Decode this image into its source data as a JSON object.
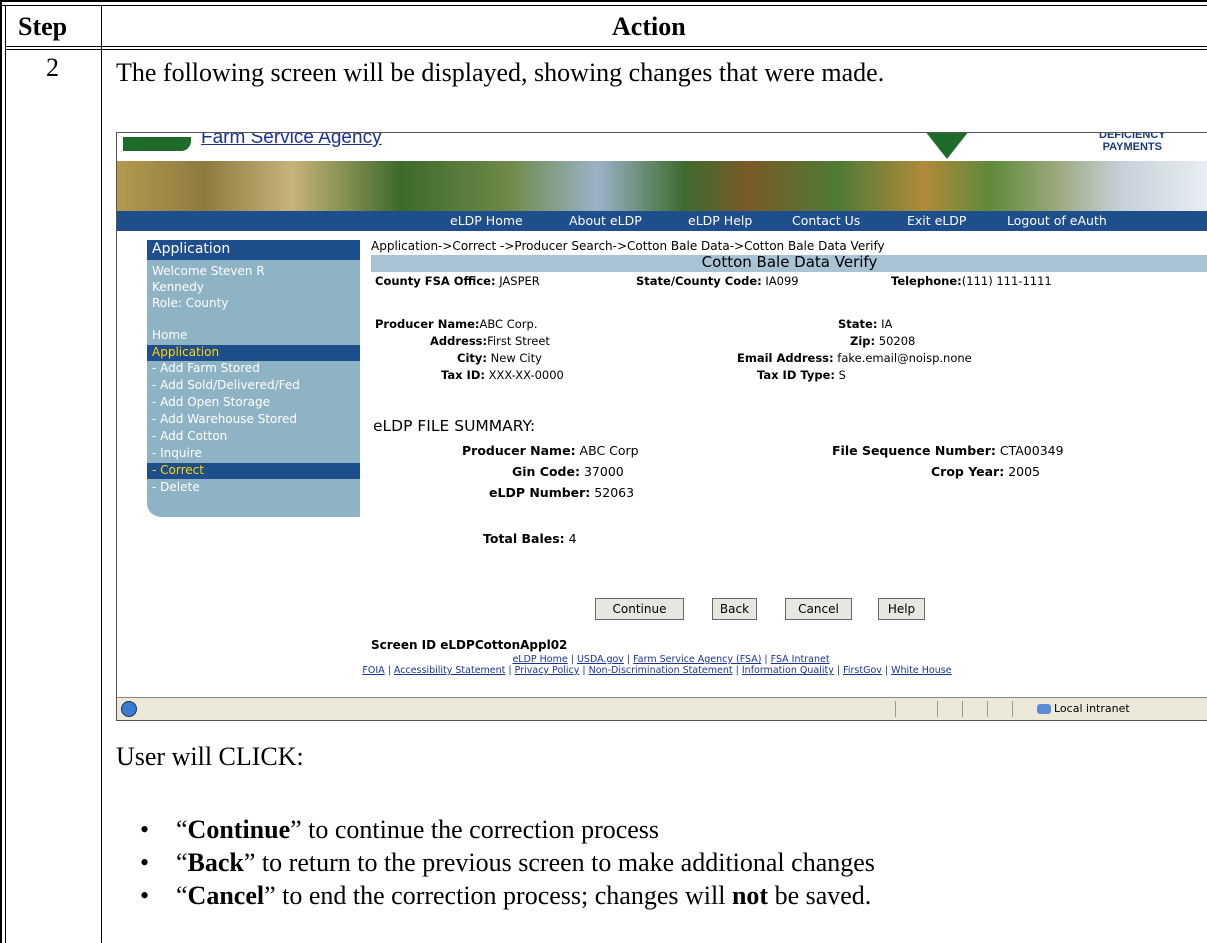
{
  "table": {
    "header_step": "Step",
    "header_action": "Action",
    "step_number": "2",
    "intro": "The following screen will be displayed, showing changes that were made.",
    "user_click": "User will CLICK:",
    "bullets": [
      {
        "quote_open": "“",
        "bold": "Continue",
        "rest": "” to continue the correction process"
      },
      {
        "quote_open": "“",
        "bold": "Back",
        "rest": "” to return to the previous screen to make additional changes"
      },
      {
        "quote_open": "“",
        "bold": "Cancel",
        "rest_a": "” to end the correction process; changes will ",
        "bold2": "not",
        "rest_b": " be saved."
      }
    ]
  },
  "screenshot": {
    "agency": "Farm Service Agency",
    "logo_line1": "DEFICIENCY",
    "logo_line2": "PAYMENTS",
    "nav": [
      "eLDP Home",
      "About eLDP",
      "eLDP Help",
      "Contact Us",
      "Exit eLDP",
      "Logout of eAuth"
    ],
    "sidebar": {
      "heading": "Application",
      "welcome_1": "Welcome  Steven R",
      "welcome_2": "Kennedy",
      "role": "Role: County",
      "home": "Home",
      "application": "Application",
      "items": [
        "- Add Farm Stored",
        "- Add Sold/Delivered/Fed",
        "- Add Open Storage",
        "- Add Warehouse Stored",
        "- Add Cotton",
        "- Inquire",
        "- Correct",
        "- Delete"
      ]
    },
    "breadcrumb": "Application->Correct ->Producer Search->Cotton Bale Data->Cotton Bale Data Verify",
    "page_title": "Cotton Bale Data Verify",
    "county_office_label": "County FSA Office:",
    "county_office": "JASPER",
    "state_county_code_label": "State/County Code:",
    "state_county_code": "IA099",
    "telephone_label": "Telephone:",
    "telephone": "(111) 111-1111",
    "producer_name_label": "Producer Name:",
    "producer_name": "ABC Corp.",
    "address_label": "Address:",
    "address": "First Street",
    "city_label": "City:",
    "city": "New City",
    "tax_id_label": "Tax ID:",
    "tax_id": "XXX-XX-0000",
    "state_label": "State:",
    "state": "IA",
    "zip_label": "Zip:",
    "zip": "50208",
    "email_label": "Email Address:",
    "email": "fake.email@noisp.none",
    "tax_id_type_label": "Tax ID Type:",
    "tax_id_type": "S",
    "summary_heading": "eLDP FILE SUMMARY:",
    "sum_producer_label": "Producer Name:",
    "sum_producer": "ABC Corp",
    "file_seq_label": "File Sequence Number:",
    "file_seq": "CTA00349",
    "gin_code_label": "Gin Code:",
    "gin_code": "37000",
    "crop_year_label": "Crop Year:",
    "crop_year": "2005",
    "eldp_number_label": "eLDP Number:",
    "eldp_number": "52063",
    "total_bales_label": "Total Bales:",
    "total_bales": "4",
    "buttons": {
      "continue": "Continue",
      "back": "Back",
      "cancel": "Cancel",
      "help": "Help"
    },
    "screen_id": "Screen ID eLDPCottonAppl02",
    "footer_links_1": [
      "eLDP Home",
      "USDA.gov",
      "Farm Service Agency (FSA)",
      "FSA Intranet"
    ],
    "footer_links_2": [
      "FOIA",
      "Accessibility Statement",
      "Privacy Policy",
      "Non-Discrimination Statement",
      "Information Quality",
      "FirstGov",
      "White House"
    ],
    "status_zone": "Local intranet"
  }
}
